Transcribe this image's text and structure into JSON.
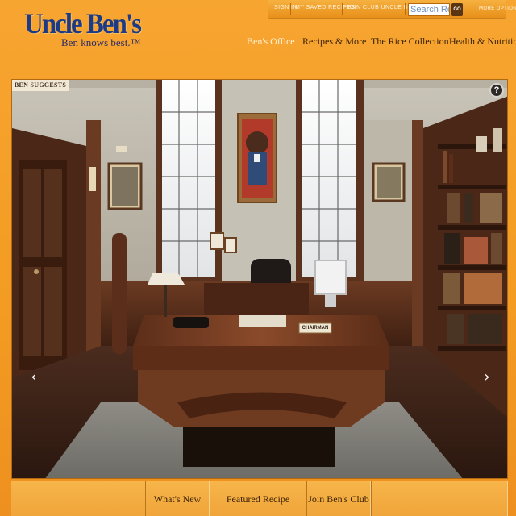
{
  "brand": {
    "logo_text": "Uncle Ben's",
    "tagline": "Ben knows best.™"
  },
  "utility": {
    "sign_in": "SIGN IN",
    "saved_recipes": "MY SAVED RECIPES",
    "join_club": "JOIN CLUB UNCLE BEN'S",
    "search_value": "Search Re",
    "go_label": "GO",
    "more_options": "MORE OPTIONS ▸"
  },
  "nav": {
    "items": [
      {
        "label": "Ben's Office",
        "active": true
      },
      {
        "label": "Recipes & More",
        "active": false
      },
      {
        "label": "The Rice Collection",
        "active": false
      },
      {
        "label": "Health & Nutrition",
        "active": false
      }
    ]
  },
  "stage": {
    "tab_label": "BEN SUGGESTS",
    "help_icon": "help-icon",
    "prev_icon": "chevron-left-icon",
    "next_icon": "chevron-right-icon",
    "help_glyph": "?",
    "prev_glyph": "‹",
    "next_glyph": "›",
    "nameplate": "CHAIRMAN"
  },
  "footer": {
    "whats_new": "What's New",
    "featured_recipe": "Featured Recipe",
    "join_club": "Join Ben's Club"
  },
  "colors": {
    "brand_blue": "#1d3a86",
    "page_orange": "#f39b22",
    "nav_text": "#3a2206"
  }
}
